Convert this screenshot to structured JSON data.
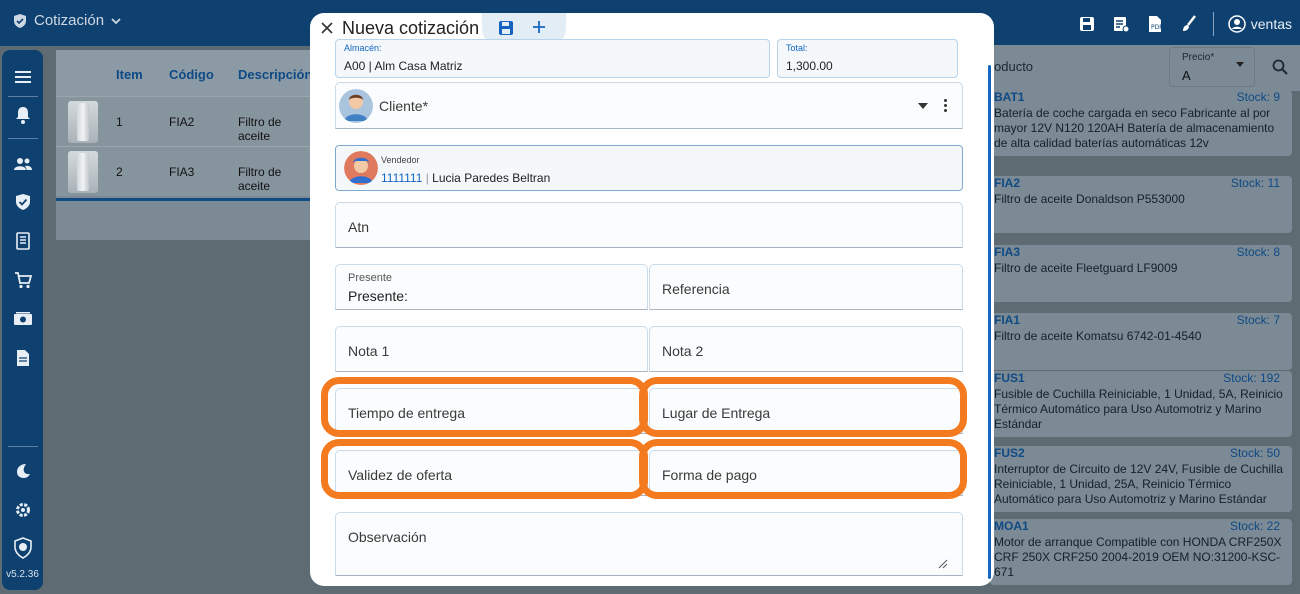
{
  "app": {
    "title": "Cotización",
    "user": "ventas",
    "version": "v5.2.36"
  },
  "table": {
    "headers": [
      "Item",
      "Código",
      "Descripción"
    ],
    "rows": [
      {
        "item": "1",
        "code": "FIA2",
        "desc": "Filtro de aceite"
      },
      {
        "item": "2",
        "code": "FIA3",
        "desc": "Filtro de aceite"
      }
    ]
  },
  "products": {
    "search_label": "oducto",
    "price_label": "Precio*",
    "price_value": "A",
    "items": [
      {
        "code": "BAT1",
        "stock_label": "Stock:",
        "stock": "9",
        "desc": "Batería de coche cargada en seco Fabricante al por mayor 12V N120 120AH Batería de almacenamiento de alta calidad baterías automáticas 12v"
      },
      {
        "code": "FIA2",
        "stock_label": "Stock:",
        "stock": "11",
        "desc": "Filtro de aceite Donaldson P553000"
      },
      {
        "code": "FIA3",
        "stock_label": "Stock:",
        "stock": "8",
        "desc": "Filtro de aceite Fleetguard LF9009"
      },
      {
        "code": "FIA1",
        "stock_label": "Stock:",
        "stock": "7",
        "desc": "Filtro de aceite Komatsu 6742-01-4540"
      },
      {
        "code": "FUS1",
        "stock_label": "Stock:",
        "stock": "192",
        "desc": "Fusible de Cuchilla Reiniciable, 1 Unidad, 5A, Reinicio Térmico Automático para Uso Automotriz y Marino Estándar"
      },
      {
        "code": "FUS2",
        "stock_label": "Stock:",
        "stock": "50",
        "desc": "Interruptor de Circuito de 12V 24V, Fusible de Cuchilla Reiniciable, 1 Unidad, 25A, Reinicio Térmico Automático para Uso Automotriz y Marino Estándar"
      },
      {
        "code": "MOA1",
        "stock_label": "Stock:",
        "stock": "22",
        "desc": "Motor de arranque Compatible con HONDA CRF250X CRF 250X CRF250 2004-2019 OEM NO:31200-KSC-671"
      }
    ]
  },
  "modal": {
    "title": "Nueva cotización",
    "almacen": {
      "label": "Almacén:",
      "value": "A00 | Alm Casa Matriz"
    },
    "total": {
      "label": "Total:",
      "value": "1,300.00"
    },
    "cliente": {
      "label": "Cliente*"
    },
    "vendedor": {
      "label": "Vendedor",
      "code": "1111111",
      "sep": " | ",
      "name": "Lucia Paredes Beltran"
    },
    "atn": "Atn",
    "presente": {
      "label": "Presente",
      "value": "Presente:"
    },
    "referencia": "Referencia",
    "nota1": "Nota 1",
    "nota2": "Nota 2",
    "tiempo_entrega": "Tiempo de entrega",
    "lugar_entrega": "Lugar de Entrega",
    "validez_oferta": "Validez de oferta",
    "forma_pago": "Forma de pago",
    "observacion": "Observación"
  },
  "colors": {
    "highlight": "#f47a1f",
    "primary": "#1565c0",
    "appbar": "#0f4170"
  }
}
